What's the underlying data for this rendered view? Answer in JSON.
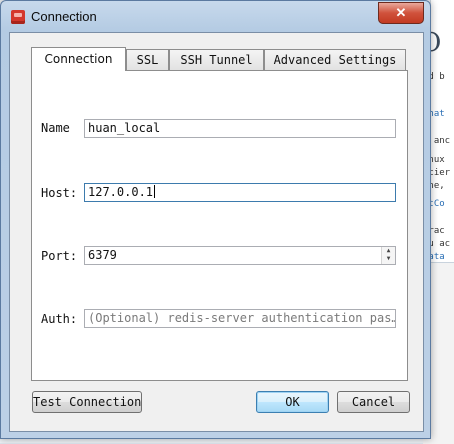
{
  "background": {
    "big_text": "O",
    "lines": [
      "ed b",
      "Chat",
      ": anc",
      "inux",
      "rcier",
      "one,",
      "QtCo",
      "trac",
      "ou ac",
      "data"
    ]
  },
  "window": {
    "title": "Connection",
    "close_glyph": "✕"
  },
  "tabs": [
    {
      "label": "Connection",
      "active": true
    },
    {
      "label": "SSL",
      "active": false
    },
    {
      "label": "SSH Tunnel",
      "active": false
    },
    {
      "label": "Advanced Settings",
      "active": false
    }
  ],
  "form": {
    "name_label": "Name",
    "name_value": "huan_local",
    "host_label": "Host:",
    "host_value": "127.0.0.1",
    "port_label": "Port:",
    "port_value": "6379",
    "auth_label": "Auth:",
    "auth_placeholder": "(Optional) redis-server authentication pas…"
  },
  "buttons": {
    "test": "Test Connection",
    "ok": "OK",
    "cancel": "Cancel"
  }
}
